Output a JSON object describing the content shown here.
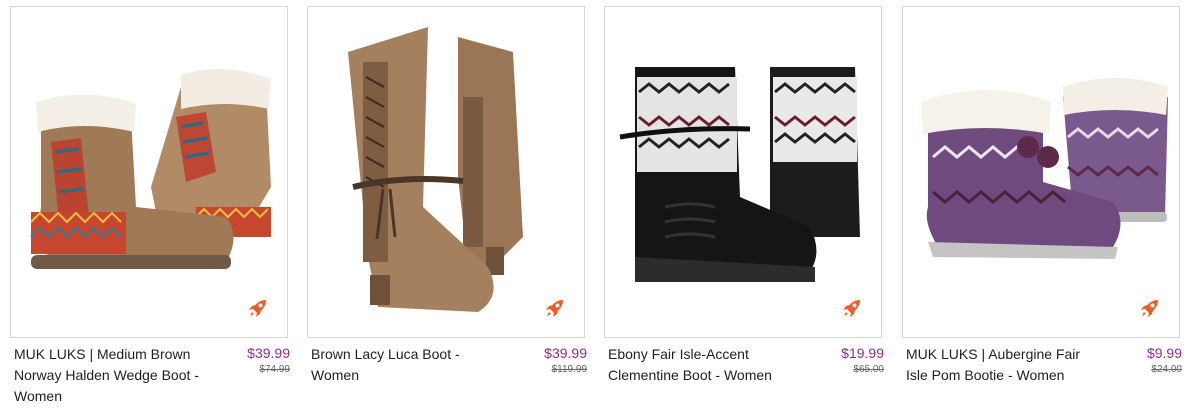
{
  "products": [
    {
      "name": "MUK LUKS | Medium Brown Norway Halden Wedge Boot - Women",
      "price": "$39.99",
      "original_price": "$74.99",
      "image_icon": "ankle-boot-wedge",
      "badge_icon": "rocket-icon"
    },
    {
      "name": "Brown Lacy Luca Boot - Women",
      "price": "$39.99",
      "original_price": "$119.99",
      "image_icon": "tall-lace-boot",
      "badge_icon": "rocket-icon"
    },
    {
      "name": "Ebony Fair Isle-Accent Clementine Boot - Women",
      "price": "$19.99",
      "original_price": "$65.00",
      "image_icon": "knit-boot",
      "badge_icon": "rocket-icon"
    },
    {
      "name": "MUK LUKS | Aubergine Fair Isle Pom Bootie - Women",
      "price": "$9.99",
      "original_price": "$24.00",
      "image_icon": "pom-bootie",
      "badge_icon": "rocket-icon"
    }
  ],
  "colors": {
    "price": "#8b2f8f",
    "badge": "#f15a24",
    "border": "#d6d6d6"
  }
}
